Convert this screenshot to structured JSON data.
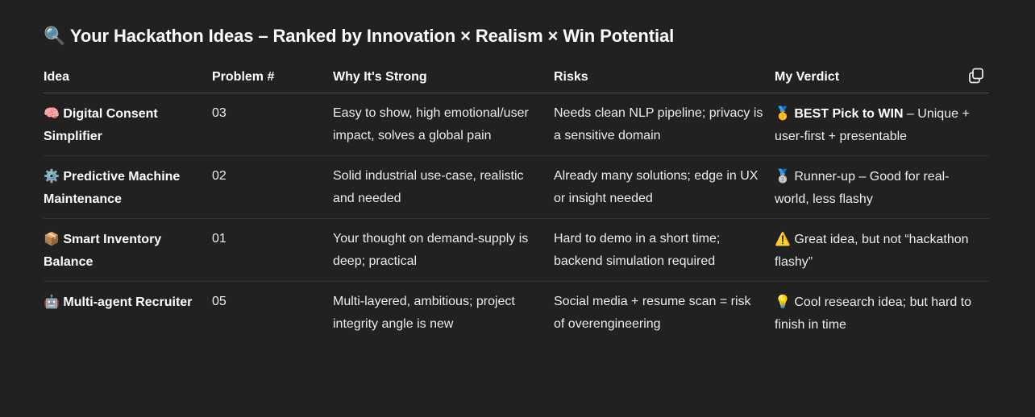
{
  "heading": {
    "icon": "🔍",
    "title": "Your Hackathon Ideas – Ranked by Innovation × Realism × Win Potential"
  },
  "table": {
    "headers": [
      "Idea",
      "Problem #",
      "Why It's Strong",
      "Risks",
      "My Verdict"
    ],
    "rows": [
      {
        "icon": "🧠",
        "idea": "Digital Consent Simplifier",
        "problem": "03",
        "strength": "Easy to show, high emotional/user impact, solves a global pain",
        "risks": "Needs clean NLP pipeline; privacy is a sensitive domain",
        "verdict_icon": "🥇",
        "verdict_bold": "BEST Pick to WIN",
        "verdict": " – Unique + user-first + presentable"
      },
      {
        "icon": "⚙️",
        "idea": "Predictive Machine Maintenance",
        "problem": "02",
        "strength": "Solid industrial use-case, realistic and needed",
        "risks": "Already many solutions; edge in UX or insight needed",
        "verdict_icon": "🥈",
        "verdict_bold": "",
        "verdict": "Runner-up – Good for real-world, less flashy"
      },
      {
        "icon": "📦",
        "idea": "Smart Inventory Balance",
        "problem": "01",
        "strength": "Your thought on demand-supply is deep; practical",
        "risks": "Hard to demo in a short time; backend simulation required",
        "verdict_icon": "⚠️",
        "verdict_bold": "",
        "verdict": "Great idea, but not “hackathon flashy”"
      },
      {
        "icon": "🤖",
        "idea": "Multi-agent Recruiter",
        "problem": "05",
        "strength": "Multi-layered, ambitious; project integrity angle is new",
        "risks": "Social media + resume scan = risk of overengineering",
        "verdict_icon": "💡",
        "verdict_bold": "",
        "verdict": "Cool research idea; but hard to finish in time"
      }
    ]
  },
  "copy_button": {
    "icon": "copy-icon"
  }
}
